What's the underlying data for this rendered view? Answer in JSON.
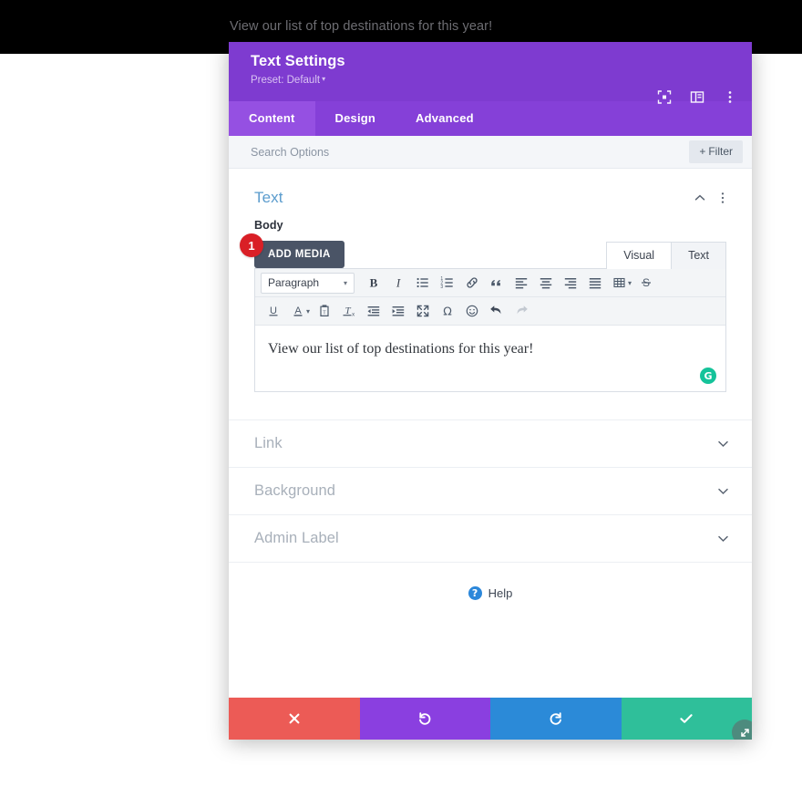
{
  "backdrop": {
    "text": "View our list of top destinations for this year!"
  },
  "modal": {
    "title": "Text Settings",
    "preset_label": "Preset: Default",
    "preset_caret": "▾",
    "header_icons": [
      {
        "name": "focus-icon"
      },
      {
        "name": "layout-panel-icon"
      },
      {
        "name": "more-vertical-icon"
      }
    ],
    "tabs": [
      {
        "label": "Content",
        "active": true
      },
      {
        "label": "Design",
        "active": false
      },
      {
        "label": "Advanced",
        "active": false
      }
    ],
    "search": {
      "placeholder": "Search Options",
      "value": ""
    },
    "filter": {
      "plus": "+",
      "label": "Filter"
    }
  },
  "text_section": {
    "title": "Text",
    "collapse_icon": "chevron-up-icon",
    "more_icon": "more-vertical-icon",
    "field_label": "Body",
    "add_media_label": "ADD MEDIA",
    "editor_tabs": [
      {
        "label": "Visual",
        "active": true
      },
      {
        "label": "Text",
        "active": false
      }
    ],
    "format_select": {
      "value": "Paragraph",
      "caret": "▾"
    },
    "toolbar_row1": [
      {
        "name": "bold-icon",
        "title": "Bold"
      },
      {
        "name": "italic-icon",
        "title": "Italic"
      },
      {
        "name": "bullet-list-icon",
        "title": "Bulleted list"
      },
      {
        "name": "numbered-list-icon",
        "title": "Numbered list"
      },
      {
        "name": "link-icon",
        "title": "Insert link"
      },
      {
        "name": "blockquote-icon",
        "title": "Blockquote"
      },
      {
        "name": "align-left-icon",
        "title": "Align left"
      },
      {
        "name": "align-center-icon",
        "title": "Align center"
      },
      {
        "name": "align-right-icon",
        "title": "Align right"
      },
      {
        "name": "align-justify-icon",
        "title": "Justify"
      },
      {
        "name": "table-icon",
        "title": "Table"
      },
      {
        "name": "strikethrough-icon",
        "title": "Strikethrough"
      }
    ],
    "toolbar_row2": [
      {
        "name": "underline-icon",
        "title": "Underline"
      },
      {
        "name": "text-color-icon",
        "title": "Text color"
      },
      {
        "name": "paste-as-text-icon",
        "title": "Paste as text"
      },
      {
        "name": "clear-formatting-icon",
        "title": "Clear formatting"
      },
      {
        "name": "outdent-icon",
        "title": "Decrease indent"
      },
      {
        "name": "indent-icon",
        "title": "Increase indent"
      },
      {
        "name": "fullscreen-icon",
        "title": "Fullscreen"
      },
      {
        "name": "special-character-icon",
        "title": "Special character"
      },
      {
        "name": "emoji-icon",
        "title": "Emoji"
      },
      {
        "name": "undo-icon",
        "title": "Undo"
      },
      {
        "name": "redo-icon",
        "title": "Redo"
      }
    ],
    "editor_value": "View our list of top destinations for this year!",
    "grammarly_label": "G",
    "step_badge": "1"
  },
  "collapsed_sections": [
    {
      "label": "Link",
      "icon": "chevron-down-icon"
    },
    {
      "label": "Background",
      "icon": "chevron-down-icon"
    },
    {
      "label": "Admin Label",
      "icon": "chevron-down-icon"
    }
  ],
  "help": {
    "icon_glyph": "?",
    "label": "Help"
  },
  "footer_buttons": [
    {
      "name": "close-button",
      "icon": "x-icon"
    },
    {
      "name": "undo-button",
      "icon": "undo-arrow-icon"
    },
    {
      "name": "redo-button",
      "icon": "redo-arrow-icon"
    },
    {
      "name": "save-button",
      "icon": "check-icon"
    }
  ],
  "resize_handle": {
    "name": "resize-handle-icon"
  },
  "colors": {
    "header_purple": "#7e3bd0",
    "tabs_purple": "#8540d8",
    "tab_active": "#9550e2",
    "section_title_blue": "#5b9ccd",
    "badge_red": "#d91f26",
    "close_red": "#ec5b56",
    "undo_purple": "#8a3fe0",
    "redo_blue": "#2b8ad8",
    "save_green": "#2fbf9a",
    "grammarly_green": "#15c39a"
  }
}
